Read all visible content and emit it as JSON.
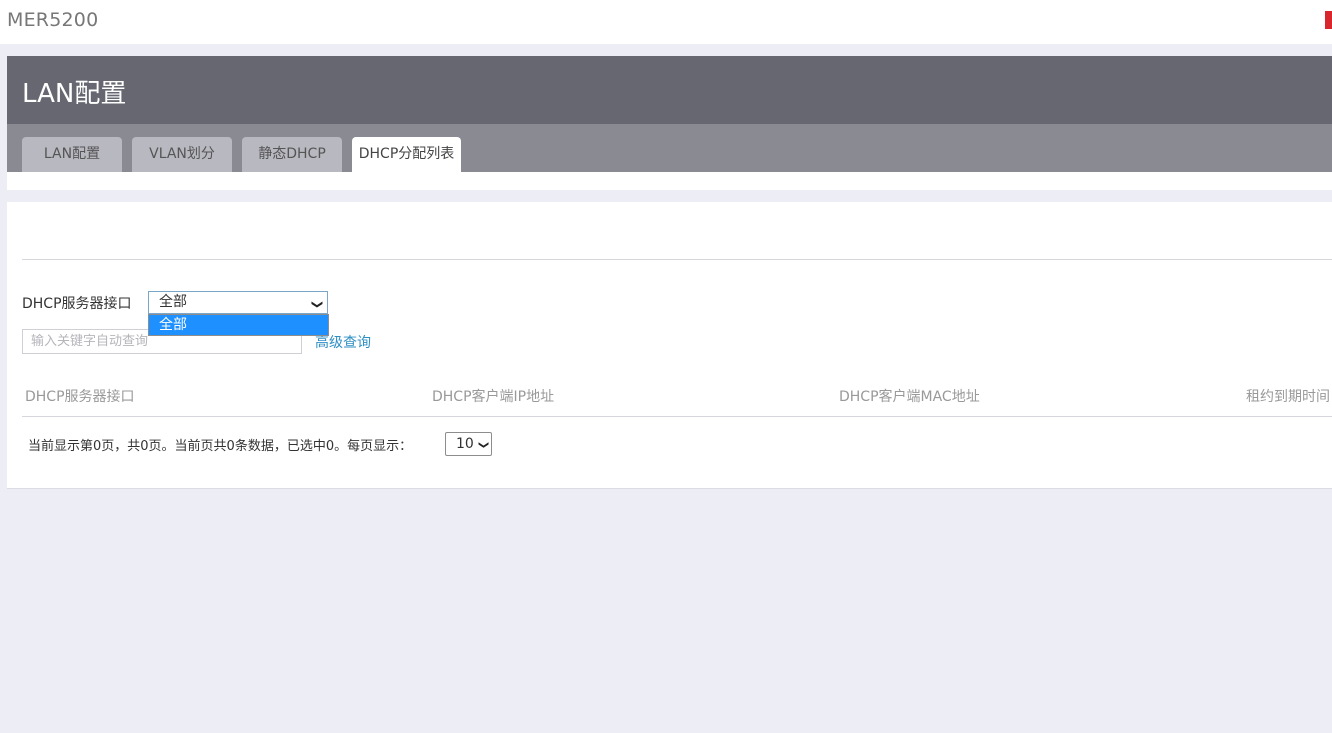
{
  "app": {
    "title": "MER5200"
  },
  "page": {
    "title": "LAN配置"
  },
  "tabs": [
    {
      "label": "LAN配置",
      "active": false
    },
    {
      "label": "VLAN划分",
      "active": false
    },
    {
      "label": "静态DHCP",
      "active": false
    },
    {
      "label": "DHCP分配列表",
      "active": true
    }
  ],
  "filter": {
    "label": "DHCP服务器接口",
    "selected": "全部",
    "options": [
      "全部"
    ]
  },
  "search": {
    "placeholder": "输入关键字自动查询",
    "value": "",
    "advanced_link": "高级查询"
  },
  "table": {
    "columns": [
      "DHCP服务器接口",
      "DHCP客户端IP地址",
      "DHCP客户端MAC地址",
      "租约到期时间"
    ],
    "rows": []
  },
  "pagination": {
    "summary": "当前显示第0页，共0页。当前页共0条数据，已选中0。每页显示：",
    "page_size": "10"
  },
  "colors": {
    "header_bg": "#666771",
    "tab_bar_bg": "#8a8a93",
    "highlight": "#1e90ff",
    "link": "#2f8fc4"
  }
}
